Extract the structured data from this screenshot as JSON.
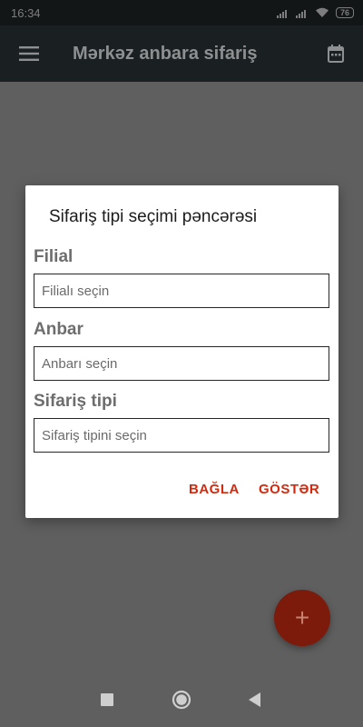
{
  "status_bar": {
    "time": "16:34",
    "signal_icon": "signal-icon",
    "wifi_icon": "wifi-icon",
    "battery_level": "76"
  },
  "app_bar": {
    "title": "Mərkəz anbara sifariş",
    "menu_icon": "hamburger-menu-icon",
    "calendar_icon": "calendar-icon"
  },
  "dialog": {
    "title": "Sifariş tipi seçimi pəncərəsi",
    "fields": [
      {
        "label": "Filial",
        "placeholder": "Filialı seçin",
        "value": ""
      },
      {
        "label": "Anbar",
        "placeholder": "Anbarı seçin",
        "value": ""
      },
      {
        "label": "Sifariş tipi",
        "placeholder": "Sifariş tipini seçin",
        "value": ""
      }
    ],
    "buttons": {
      "close": "BAĞLA",
      "show": "GÖSTƏR"
    }
  },
  "fab": {
    "label": "+",
    "icon": "add-icon"
  },
  "nav_bar": {
    "recents_icon": "square-recents-icon",
    "home_icon": "circle-home-icon",
    "back_icon": "triangle-back-icon"
  },
  "colors": {
    "accent": "#d32a0f",
    "app_bar": "#1a2022",
    "scrim": "#5f5f5f",
    "fab": "#7c1a0c"
  }
}
